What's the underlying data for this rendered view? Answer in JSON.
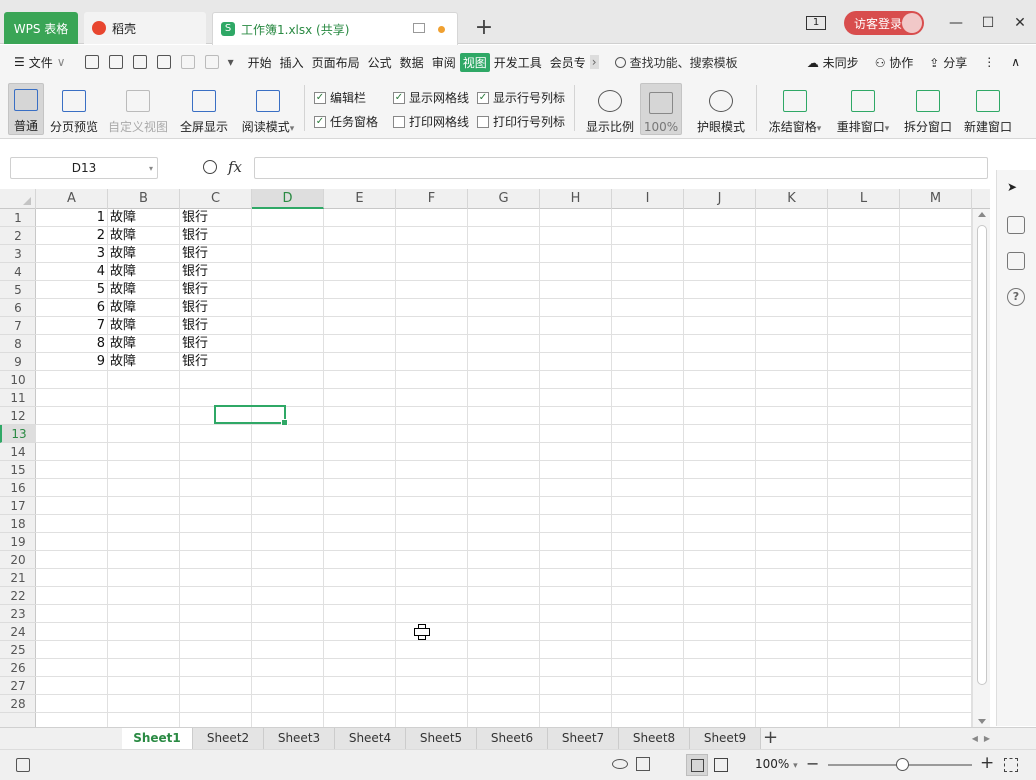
{
  "tabs": {
    "wps": "WPS 表格",
    "daoke": "稻壳",
    "workbook": "工作簿1.xlsx (共享)",
    "add": "+"
  },
  "window": {
    "page_indicator": "1",
    "login": "访客登录",
    "minimize": "—",
    "restore": "☐",
    "close": "✕"
  },
  "menu": {
    "file": "文件",
    "file_arrow": "∨",
    "more_arrow": "▾",
    "items": [
      "开始",
      "插入",
      "页面布局",
      "公式",
      "数据",
      "审阅",
      "视图",
      "开发工具",
      "会员专"
    ],
    "overflow": "›",
    "search": "查找功能、搜索模板",
    "sync": "未同步",
    "collab": "协作",
    "share": "分享",
    "more": "⋮",
    "collapse": "∧"
  },
  "ribbon": {
    "normal": "普通",
    "page_preview": "分页预览",
    "custom_view": "自定义视图",
    "fullscreen": "全屏显示",
    "read_mode": "阅读模式",
    "edit_bar": "编辑栏",
    "task_pane": "任务窗格",
    "show_grid": "显示网格线",
    "print_grid": "打印网格线",
    "show_headers": "显示行号列标",
    "print_headers": "打印行号列标",
    "zoom_ratio": "显示比例",
    "zoom_100": "100%",
    "eye_mode": "护眼模式",
    "freeze": "冻结窗格",
    "rearrange": "重排窗口",
    "split": "拆分窗口",
    "new_window": "新建窗口",
    "checkmark": "✓",
    "dropdown": "▾"
  },
  "formula_bar": {
    "name_box": "D13",
    "fx": "fx",
    "formula": ""
  },
  "grid": {
    "columns": [
      "A",
      "B",
      "C",
      "D",
      "E",
      "F",
      "G",
      "H",
      "I",
      "J",
      "K",
      "L",
      "M"
    ],
    "active_column": "D",
    "rows": [
      "1",
      "2",
      "3",
      "4",
      "5",
      "6",
      "7",
      "8",
      "9",
      "10",
      "11",
      "12",
      "13",
      "14",
      "15",
      "16",
      "17",
      "18",
      "19",
      "20",
      "21",
      "22",
      "23",
      "24",
      "25",
      "26",
      "27",
      "28"
    ],
    "active_row": "13",
    "data": [
      {
        "a": "1",
        "b": "故障",
        "c": "银行"
      },
      {
        "a": "2",
        "b": "故障",
        "c": "银行"
      },
      {
        "a": "3",
        "b": "故障",
        "c": "银行"
      },
      {
        "a": "4",
        "b": "故障",
        "c": "银行"
      },
      {
        "a": "5",
        "b": "故障",
        "c": "银行"
      },
      {
        "a": "6",
        "b": "故障",
        "c": "银行"
      },
      {
        "a": "7",
        "b": "故障",
        "c": "银行"
      },
      {
        "a": "8",
        "b": "故障",
        "c": "银行"
      },
      {
        "a": "9",
        "b": "故障",
        "c": "银行"
      }
    ]
  },
  "sheets": [
    "Sheet1",
    "Sheet2",
    "Sheet3",
    "Sheet4",
    "Sheet5",
    "Sheet6",
    "Sheet7",
    "Sheet8",
    "Sheet9"
  ],
  "active_sheet": "Sheet1",
  "sheet_add": "+",
  "sheet_nav": "◀▶",
  "statusbar": {
    "zoom": "100%",
    "zoom_dropdown": "▾",
    "minus": "−",
    "plus": "+"
  },
  "colors": {
    "accent": "#2fa866",
    "wps_tab": "#3aa556",
    "login": "#d84d4d"
  }
}
